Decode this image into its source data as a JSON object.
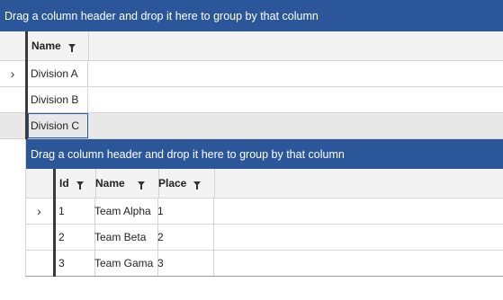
{
  "outer": {
    "group_panel_text": "Drag a column header and drop it here to group by that column",
    "columns": [
      {
        "label": "Name"
      }
    ],
    "rows": [
      {
        "name": "Division A",
        "expander": "›"
      },
      {
        "name": "Division B"
      },
      {
        "name": "Division C"
      }
    ]
  },
  "inner": {
    "group_panel_text": "Drag a column header and drop it here to group by that column",
    "columns": [
      {
        "label": "Id"
      },
      {
        "label": "Name"
      },
      {
        "label": "Place"
      }
    ],
    "rows": [
      {
        "id": "1",
        "name": "Team Alpha",
        "place": "1",
        "expander": "›"
      },
      {
        "id": "2",
        "name": "Team Beta",
        "place": "2"
      },
      {
        "id": "3",
        "name": "Team Gama",
        "place": "3"
      }
    ]
  },
  "colors": {
    "group_panel": "#2b579a",
    "row_divider": "#d4d4d4",
    "selected_row": "#e8e8e8"
  },
  "icons": {
    "expander": "chevron-right-icon",
    "filter": "filter-icon"
  }
}
